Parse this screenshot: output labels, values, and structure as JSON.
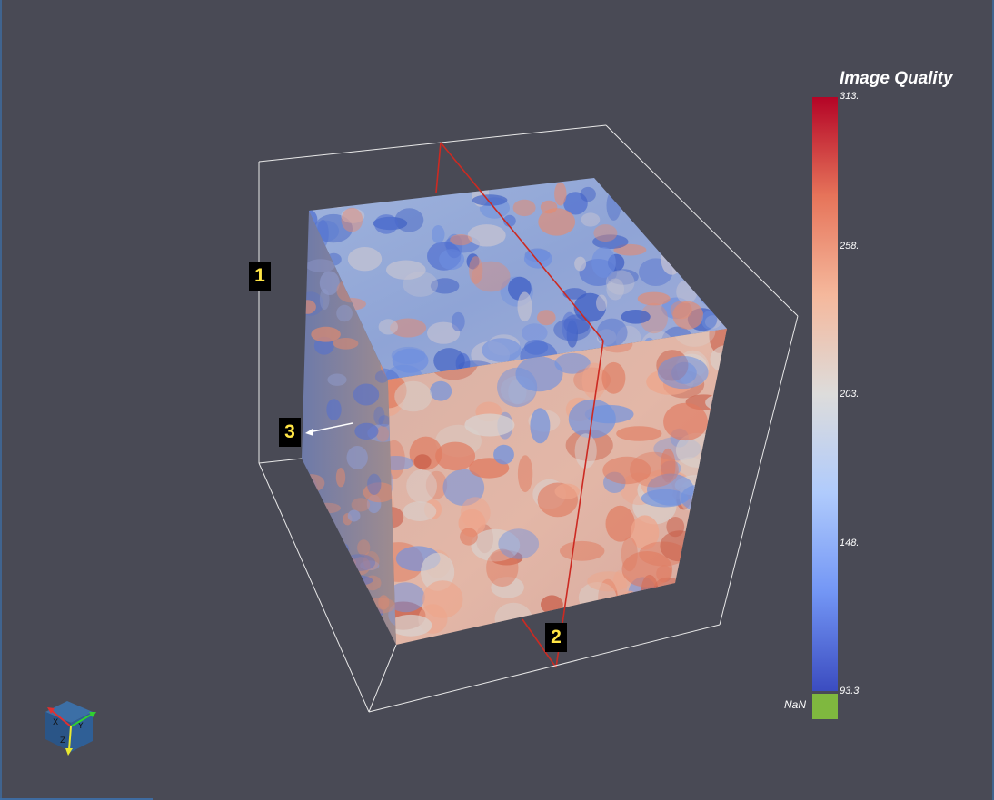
{
  "viewer": {
    "colors": {
      "background": "#494a55",
      "bounding_box": "#e8e8e8",
      "slice_line": "#cc2a22",
      "callout_bg": "#000000",
      "callout_text": "#ffe545",
      "nan": "#7fb83f"
    }
  },
  "callouts": [
    "1",
    "2",
    "3"
  ],
  "colorbar": {
    "title": "Image Quality",
    "ticks": [
      "313.",
      "258.",
      "203.",
      "148.",
      "93.3"
    ],
    "tick_values": [
      313,
      258,
      203,
      148,
      93.3
    ],
    "range": [
      93.3,
      313
    ],
    "colormap": [
      "#3b4cc0",
      "#7396f5",
      "#b0cbfc",
      "#dddcdb",
      "#f5b89c",
      "#e6745a",
      "#b40426"
    ],
    "nan_label": "NaN"
  },
  "orientation_axes": {
    "icon": "orientation-cube-icon",
    "axis_colors": [
      "#e03030",
      "#30d030",
      "#e8e830"
    ]
  }
}
